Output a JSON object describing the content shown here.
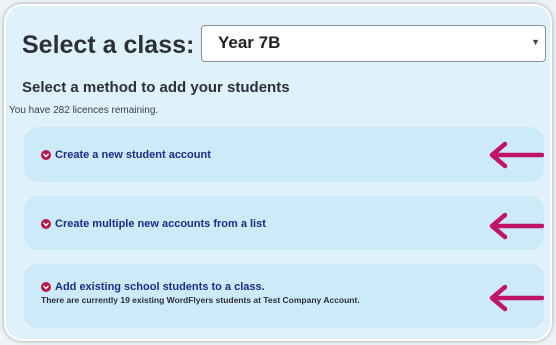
{
  "header": {
    "title": "Select a class:"
  },
  "class_select": {
    "selected": "Year 7B"
  },
  "main": {
    "heading": "Select a method to add your students",
    "licences": "You have 282 licences remaining."
  },
  "options": [
    {
      "label": "Create a new student account"
    },
    {
      "label": "Create multiple new accounts from a list"
    },
    {
      "label": "Add existing school students to a class.",
      "sub": "There are currently 19 existing WordFlyers students at Test Company Account."
    }
  ],
  "colors": {
    "accent": "#b5174e",
    "link": "#1e2b8a",
    "panel": "#dff1fb",
    "option_bg": "#cdeaf8"
  },
  "icons": {
    "option": "chevron-down-circle-icon",
    "annotation": "arrow-left-icon"
  }
}
